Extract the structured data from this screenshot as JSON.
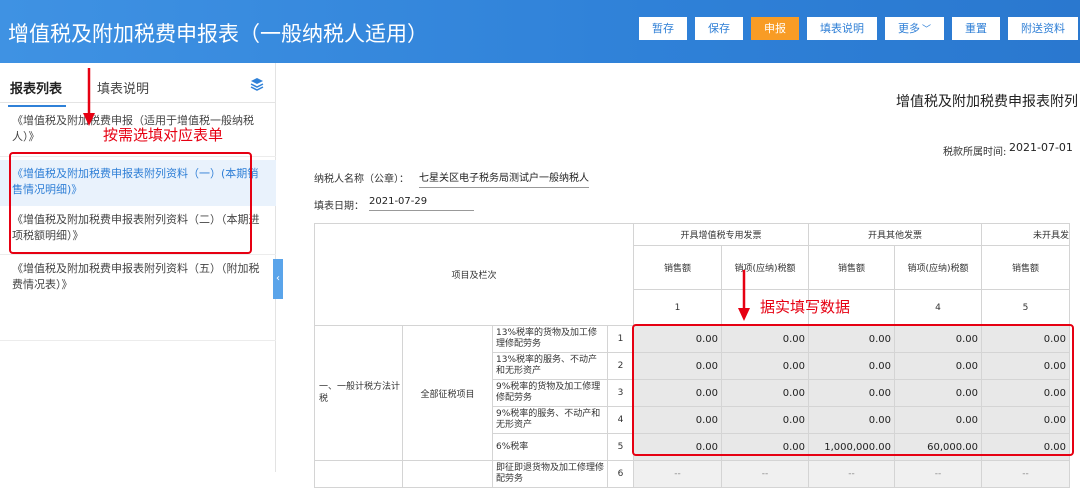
{
  "header": {
    "title": "增值税及附加税费申报表（一般纳税人适用）",
    "buttons": {
      "temp_save": "暂存",
      "save": "保存",
      "declare": "申报",
      "fill_guide": "填表说明",
      "more": "更多",
      "reset": "重置",
      "attach": "附送资料"
    }
  },
  "sidebar": {
    "tabs": {
      "list": "报表列表",
      "guide": "填表说明"
    },
    "items": [
      {
        "label": "《增值税及附加税费申报（适用于增值税一般纳税人）》"
      },
      {
        "label": "《增值税及附加税费申报表附列资料（一）(本期销售情况明细)》"
      },
      {
        "label": "《增值税及附加税费申报表附列资料（二）（本期进项税额明细）》"
      },
      {
        "label": "《增值税及附加税费申报表附列资料（五）（附加税费情况表）》"
      }
    ]
  },
  "annotations": {
    "sidebar_note": "按需选填对应表单",
    "table_note": "据实填写数据"
  },
  "main": {
    "doc_title": "增值税及附加税费申报表附列",
    "period_label": "税款所属时间:",
    "period_value": "2021-07-01",
    "taxpayer_label": "纳税人名称（公章）：",
    "taxpayer_value": "七星关区电子税务局测试户一般纳税人",
    "fill_date_label": "填表日期：",
    "fill_date_value": "2021-07-29"
  },
  "table": {
    "item_header": "项目及栏次",
    "groups": [
      "开具增值税专用发票",
      "开具其他发票",
      "未开具发"
    ],
    "subheaders": [
      "销售额",
      "销项(应纳)税额",
      "销售额",
      "销项(应纳)税额",
      "销售额"
    ],
    "col_numbers": [
      "1",
      "",
      "",
      "4",
      "5"
    ],
    "section": "一、一般计税方法计税",
    "subsection": "全部征税项目",
    "rows": [
      {
        "desc": "13%税率的货物及加工修理修配劳务",
        "no": "1",
        "values": [
          "0.00",
          "0.00",
          "0.00",
          "0.00",
          "0.00"
        ]
      },
      {
        "desc": "13%税率的服务、不动产和无形资产",
        "no": "2",
        "values": [
          "0.00",
          "0.00",
          "0.00",
          "0.00",
          "0.00"
        ]
      },
      {
        "desc": "9%税率的货物及加工修理修配劳务",
        "no": "3",
        "values": [
          "0.00",
          "0.00",
          "0.00",
          "0.00",
          "0.00"
        ]
      },
      {
        "desc": "9%税率的服务、不动产和无形资产",
        "no": "4",
        "values": [
          "0.00",
          "0.00",
          "0.00",
          "0.00",
          "0.00"
        ]
      },
      {
        "desc": "6%税率",
        "no": "5",
        "values": [
          "0.00",
          "0.00",
          "1,000,000.00",
          "60,000.00",
          "0.00"
        ]
      },
      {
        "desc": "即征即退货物及加工修理修配劳务",
        "no": "6",
        "values": [
          "--",
          "--",
          "--",
          "--",
          "--"
        ]
      }
    ]
  },
  "colors": {
    "header_bg": "#2f81d8",
    "accent_orange": "#f89c25",
    "annotation_red": "#e60012",
    "selected_blue": "#2f7fd6"
  }
}
